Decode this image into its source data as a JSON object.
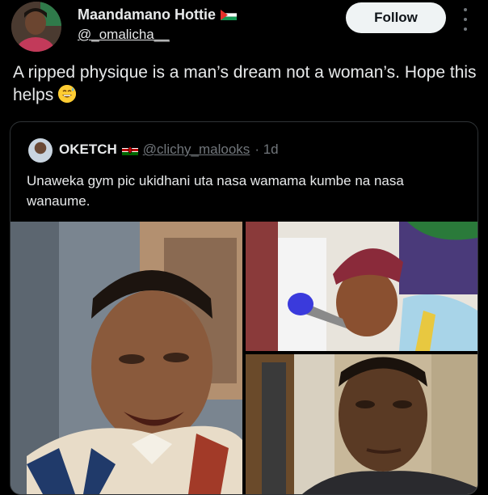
{
  "author": {
    "name": "Maandamano Hottie",
    "handle": "@_omalicha__"
  },
  "follow_label": "Follow",
  "tweet": {
    "text": "A ripped physique is a man’s dream not a woman’s. Hope this helps"
  },
  "quote": {
    "name": "OKETCH",
    "handle": "@clichy_malooks",
    "time": "· 1d",
    "text": "Unaweka gym pic ukidhani uta nasa wamama kumbe na nasa wanaume."
  },
  "icons": {
    "author_flag": "palestine-flag-icon",
    "quote_flag": "kenya-flag-icon",
    "emoji": "grinning-sweat-emoji-icon",
    "more": "more-vertical-icon"
  },
  "colors": {
    "background": "#000000",
    "text": "#e7e9ea",
    "muted": "#71767b",
    "border": "#2f3336",
    "follow_bg": "#eff3f4"
  }
}
